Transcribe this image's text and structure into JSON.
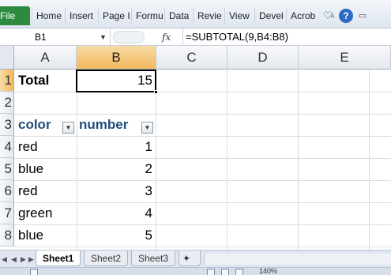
{
  "ribbon": {
    "file_label": "File",
    "tabs": [
      "Home",
      "Insert",
      "Page I",
      "Formu",
      "Data",
      "Revie",
      "View",
      "Devel",
      "Acrob"
    ],
    "overflow_glyph": "♡",
    "minimize_glyph": "▵",
    "help_glyph": "?",
    "restore_glyph": "▭"
  },
  "formula_bar": {
    "name_box": "B1",
    "fx_label": "fx",
    "formula": "=SUBTOTAL(9,B4:B8)"
  },
  "grid": {
    "columns": [
      "A",
      "B",
      "C",
      "D",
      "E"
    ],
    "selected_column": "B",
    "rows": [
      "1",
      "2",
      "3",
      "4",
      "5",
      "6",
      "7",
      "8"
    ],
    "selected_row": "1",
    "cells": {
      "a1": "Total",
      "b1": "15",
      "a3": "color",
      "b3": "number",
      "a4": "red",
      "b4": "1",
      "a5": "blue",
      "b5": "2",
      "a6": "red",
      "b6": "3",
      "a7": "green",
      "b7": "4",
      "a8": "blue",
      "b8": "5"
    }
  },
  "sheets": {
    "tabs": [
      "Sheet1",
      "Sheet2",
      "Sheet3"
    ],
    "active": "Sheet1"
  },
  "status": {
    "zoom": "140%"
  },
  "colors": {
    "file_tab": "#2d8a3e",
    "selected_header": "#f2b95c",
    "table_header_text": "#1f4e79"
  }
}
